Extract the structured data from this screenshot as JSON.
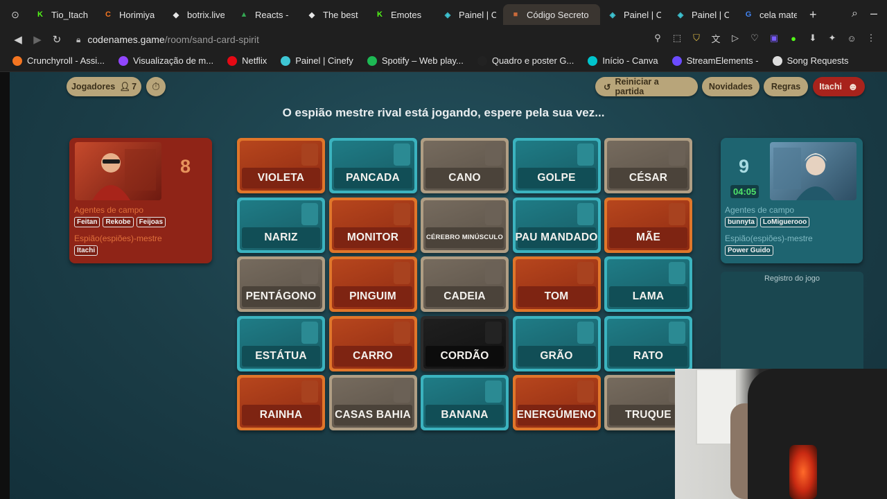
{
  "browser": {
    "tabs": [
      {
        "label": "Tio_Itach",
        "color": "#53fc18",
        "glyph": "K"
      },
      {
        "label": "Horimiya",
        "color": "#f47521",
        "glyph": "C"
      },
      {
        "label": "botrix.live",
        "color": "#e6e6e6",
        "glyph": "◆"
      },
      {
        "label": "Reacts -",
        "color": "#34a853",
        "glyph": "▲"
      },
      {
        "label": "The best",
        "color": "#e6e6e6",
        "glyph": "◆"
      },
      {
        "label": "Emotes",
        "color": "#53fc18",
        "glyph": "K"
      },
      {
        "label": "Painel | C",
        "color": "#3ec6d4",
        "glyph": "◈"
      },
      {
        "label": "Código Secreto",
        "color": "#c96a3a",
        "glyph": "■"
      },
      {
        "label": "Painel | C",
        "color": "#3ec6d4",
        "glyph": "◈"
      },
      {
        "label": "Painel | C",
        "color": "#3ec6d4",
        "glyph": "◈"
      },
      {
        "label": "cela mate",
        "color": "#4285f4",
        "glyph": "G"
      }
    ],
    "new_tab": "+",
    "url_domain": "codenames.game",
    "url_path": "/room/sand-card-spirit",
    "bookmarks": [
      {
        "label": "Crunchyroll - Assi...",
        "color": "#f47521"
      },
      {
        "label": "Visualização de m...",
        "color": "#9146ff"
      },
      {
        "label": "Netflix",
        "color": "#e50914"
      },
      {
        "label": "Painel | Cinefy",
        "color": "#3ec6d4"
      },
      {
        "label": "Spotify – Web play...",
        "color": "#1db954"
      },
      {
        "label": "Quadro e poster G...",
        "color": "#222222"
      },
      {
        "label": "Início - Canva",
        "color": "#00c4cc"
      },
      {
        "label": "StreamElements -",
        "color": "#6b4bff"
      },
      {
        "label": "Song Requests",
        "color": "#dddddd"
      }
    ]
  },
  "game": {
    "players_label": "Jogadores",
    "players_count": "7",
    "restart_label": "Reiniciar a partida",
    "news_label": "Novidades",
    "rules_label": "Regras",
    "user_label": "Itachi",
    "status_text": "O espião mestre rival está jogando, espere pela sua vez...",
    "log_title": "Registro do jogo"
  },
  "teams": {
    "red": {
      "score": "8",
      "agents_label": "Agentes de campo",
      "agents": [
        "Feitan",
        "Rekobe",
        "Feijoas"
      ],
      "spymaster_label": "Espião(espiões)-mestre",
      "spymasters": [
        "Itachi"
      ]
    },
    "blue": {
      "score": "9",
      "timer": "04:05",
      "agents_label": "Agentes de campo",
      "agents": [
        "bunnyta",
        "LoMiguerooo"
      ],
      "spymaster_label": "Espião(espiões)-mestre",
      "spymasters": [
        "Power Guido"
      ]
    }
  },
  "cards": [
    {
      "word": "VIOLETA",
      "team": "red"
    },
    {
      "word": "PANCADA",
      "team": "blue"
    },
    {
      "word": "CANO",
      "team": "neutral"
    },
    {
      "word": "GOLPE",
      "team": "blue"
    },
    {
      "word": "CÉSAR",
      "team": "neutral"
    },
    {
      "word": "NARIZ",
      "team": "blue"
    },
    {
      "word": "MONITOR",
      "team": "red"
    },
    {
      "word": "CÉREBRO MINÚSCULO",
      "team": "neutral"
    },
    {
      "word": "PAU MANDADO",
      "team": "blue"
    },
    {
      "word": "MÃE",
      "team": "red"
    },
    {
      "word": "PENTÁGONO",
      "team": "neutral"
    },
    {
      "word": "PINGUIM",
      "team": "red"
    },
    {
      "word": "CADEIA",
      "team": "neutral"
    },
    {
      "word": "TOM",
      "team": "red"
    },
    {
      "word": "LAMA",
      "team": "blue"
    },
    {
      "word": "ESTÁTUA",
      "team": "blue"
    },
    {
      "word": "CARRO",
      "team": "red"
    },
    {
      "word": "CORDÃO",
      "team": "assassin"
    },
    {
      "word": "GRÃO",
      "team": "blue"
    },
    {
      "word": "RATO",
      "team": "blue"
    },
    {
      "word": "RAINHA",
      "team": "red"
    },
    {
      "word": "CASAS BAHIA",
      "team": "neutral"
    },
    {
      "word": "BANANA",
      "team": "blue"
    },
    {
      "word": "ENERGÚMENO",
      "team": "red"
    },
    {
      "word": "TRUQUE",
      "team": "neutral"
    }
  ]
}
